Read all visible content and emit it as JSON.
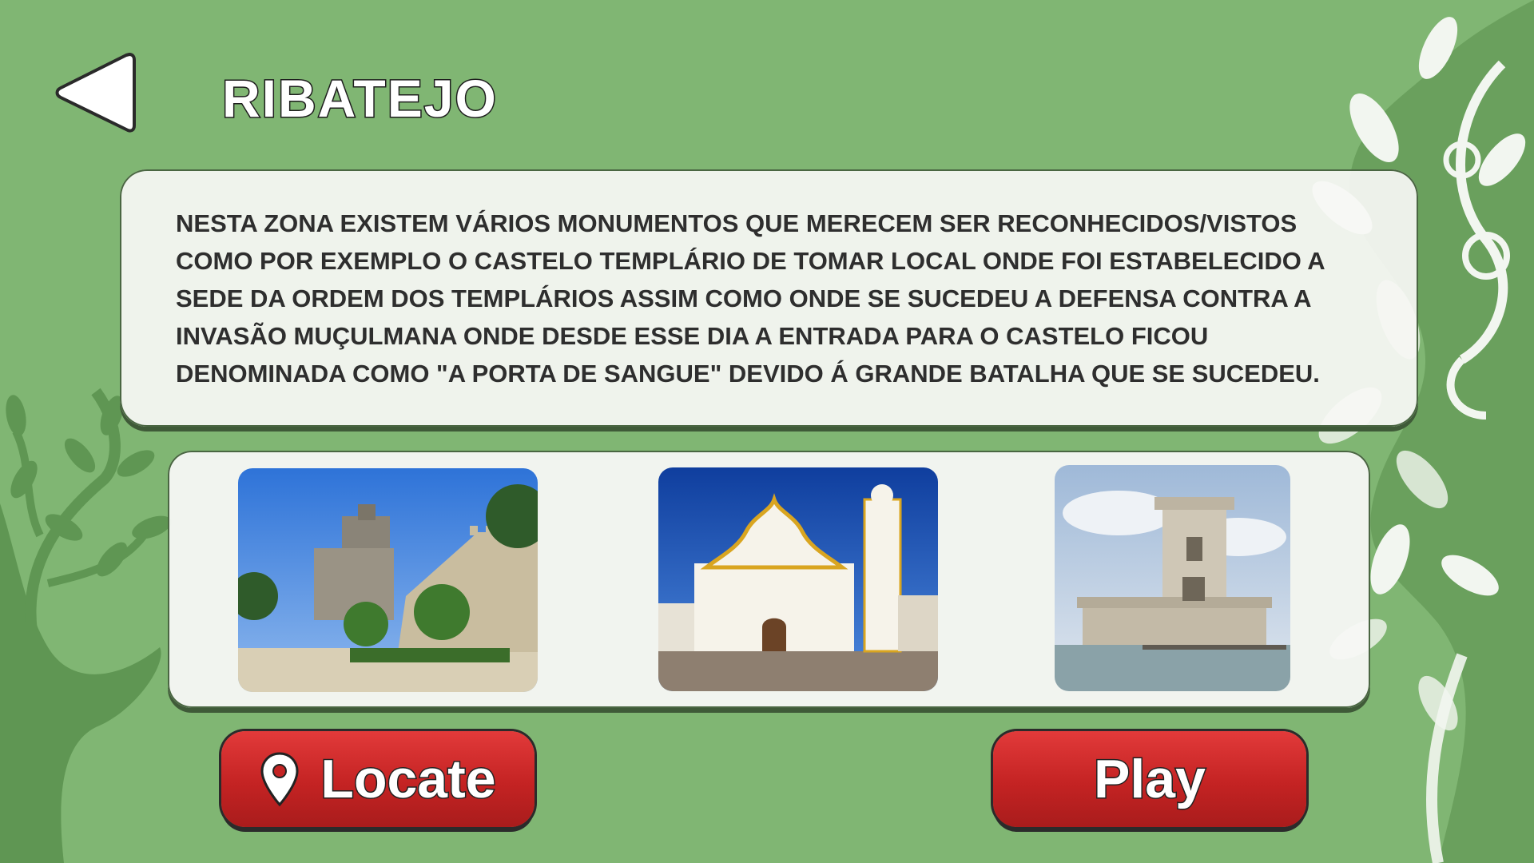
{
  "header": {
    "back_icon": "back-arrow-icon",
    "title": "RIBATEJO"
  },
  "description": {
    "text": "NESTA ZONA EXISTEM VÁRIOS MONUMENTOS QUE MERECEM SER RECONHECIDOS/VISTOS COMO POR EXEMPLO O CASTELO TEMPLÁRIO DE TOMAR LOCAL ONDE FOI ESTABELECIDO A SEDE DA ORDEM DOS TEMPLÁRIOS ASSIM COMO ONDE SE SUCEDEU A DEFENSA CONTRA A INVASÃO MUÇULMANA ONDE DESDE ESSE DIA A ENTRADA PARA O CASTELO FICOU DENOMINADA COMO \"A PORTA DE SANGUE\" DEVIDO Á GRANDE BATALHA QUE SE SUCEDEU."
  },
  "gallery": {
    "photos": [
      "castle-photo",
      "church-photo",
      "tower-photo"
    ]
  },
  "actions": {
    "locate_label": "Locate",
    "locate_icon": "map-pin-icon",
    "play_label": "Play"
  },
  "colors": {
    "background": "#80b673",
    "button_red": "#c42323",
    "card": "#f7f8f5"
  }
}
